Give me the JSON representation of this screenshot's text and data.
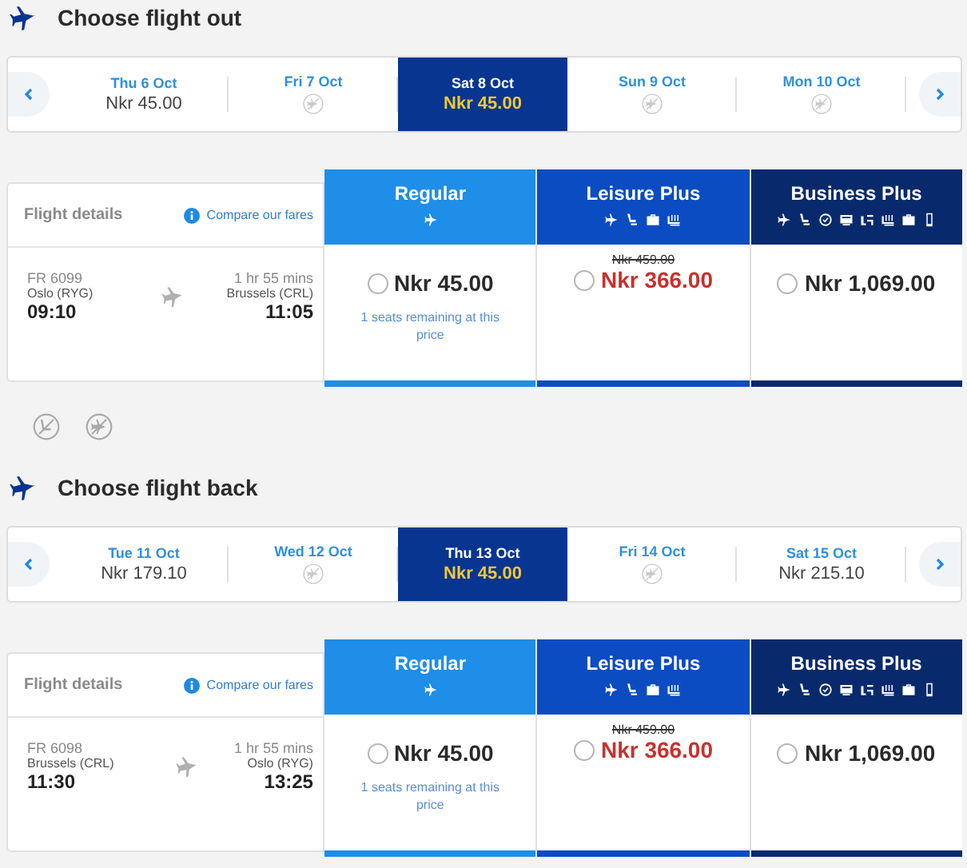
{
  "sections": [
    {
      "title": "Choose flight out",
      "dates": [
        {
          "label": "Thu 6 Oct",
          "price": "Nkr 45.00",
          "selected": false
        },
        {
          "label": "Fri 7 Oct",
          "selected": false
        },
        {
          "label": "Sat 8 Oct",
          "price": "Nkr 45.00",
          "selected": true
        },
        {
          "label": "Sun 9 Oct",
          "selected": false
        },
        {
          "label": "Mon 10 Oct",
          "selected": false
        }
      ],
      "flight": {
        "details_label": "Flight details",
        "compare_link": "Compare our fares",
        "number": "FR 6099",
        "duration": "1 hr 55 mins",
        "from": "Oslo (RYG)",
        "to": "Brussels (CRL)",
        "depart": "09:10",
        "arrive": "11:05"
      },
      "fares": [
        {
          "kind": "regular",
          "name": "Regular",
          "price": "Nkr 45.00",
          "note": "1 seats remaining at this price",
          "selected": false
        },
        {
          "kind": "leisure",
          "name": "Leisure Plus",
          "old_price": "Nkr 459.00",
          "price": "Nkr 366.00",
          "selected": false
        },
        {
          "kind": "business",
          "name": "Business Plus",
          "price": "Nkr 1,069.00",
          "selected": false
        }
      ],
      "notice_icons": [
        {
          "kind": "seat"
        },
        {
          "kind": "plane"
        }
      ]
    },
    {
      "title": "Choose flight back",
      "dates": [
        {
          "label": "Tue 11 Oct",
          "price": "Nkr 179.10",
          "selected": false
        },
        {
          "label": "Wed 12 Oct",
          "selected": false
        },
        {
          "label": "Thu 13 Oct",
          "price": "Nkr 45.00",
          "selected": true
        },
        {
          "label": "Fri 14 Oct",
          "selected": false
        },
        {
          "label": "Sat 15 Oct",
          "price": "Nkr 215.10",
          "selected": false
        }
      ],
      "flight": {
        "details_label": "Flight details",
        "compare_link": "Compare our fares",
        "number": "FR 6098",
        "duration": "1 hr 55 mins",
        "from": "Brussels (CRL)",
        "to": "Oslo (RYG)",
        "depart": "11:30",
        "arrive": "13:25"
      },
      "fares": [
        {
          "kind": "regular",
          "name": "Regular",
          "price": "Nkr 45.00",
          "note": "1 seats remaining at this price",
          "selected": false
        },
        {
          "kind": "leisure",
          "name": "Leisure Plus",
          "old_price": "Nkr 459.00",
          "price": "Nkr 366.00",
          "selected": false
        },
        {
          "kind": "business",
          "name": "Business Plus",
          "price": "Nkr 1,069.00",
          "selected": false
        }
      ]
    }
  ]
}
